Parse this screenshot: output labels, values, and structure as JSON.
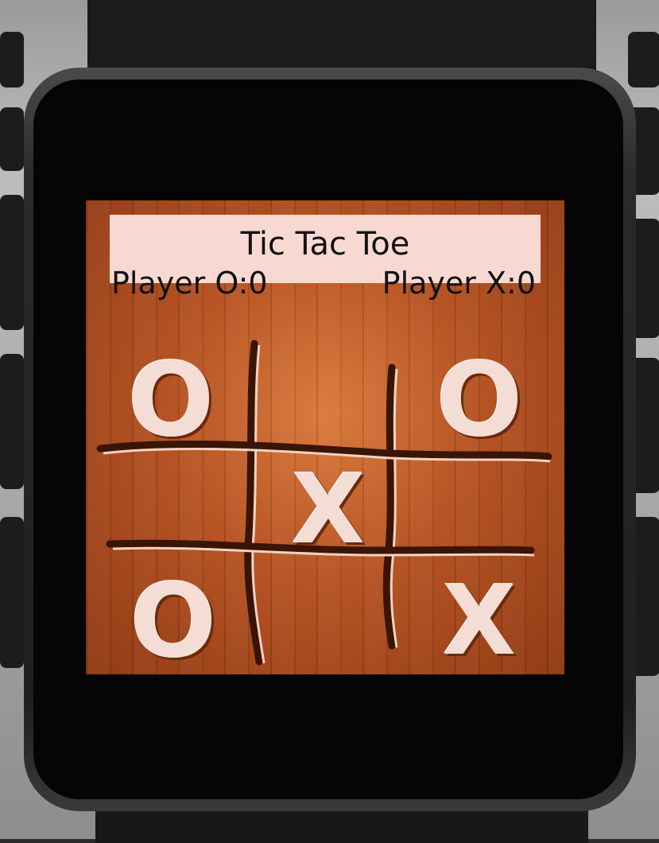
{
  "app": {
    "title": "Tic Tac Toe"
  },
  "scores": {
    "player_o": "Player O:0",
    "player_x": "Player X:0"
  },
  "board": [
    [
      "O",
      "",
      "O"
    ],
    [
      "",
      "X",
      ""
    ],
    [
      "O",
      "",
      "X"
    ]
  ],
  "colors": {
    "wood": "#b55120",
    "title_bar": "#f8d9d2",
    "mark": "#f4ddd5"
  }
}
